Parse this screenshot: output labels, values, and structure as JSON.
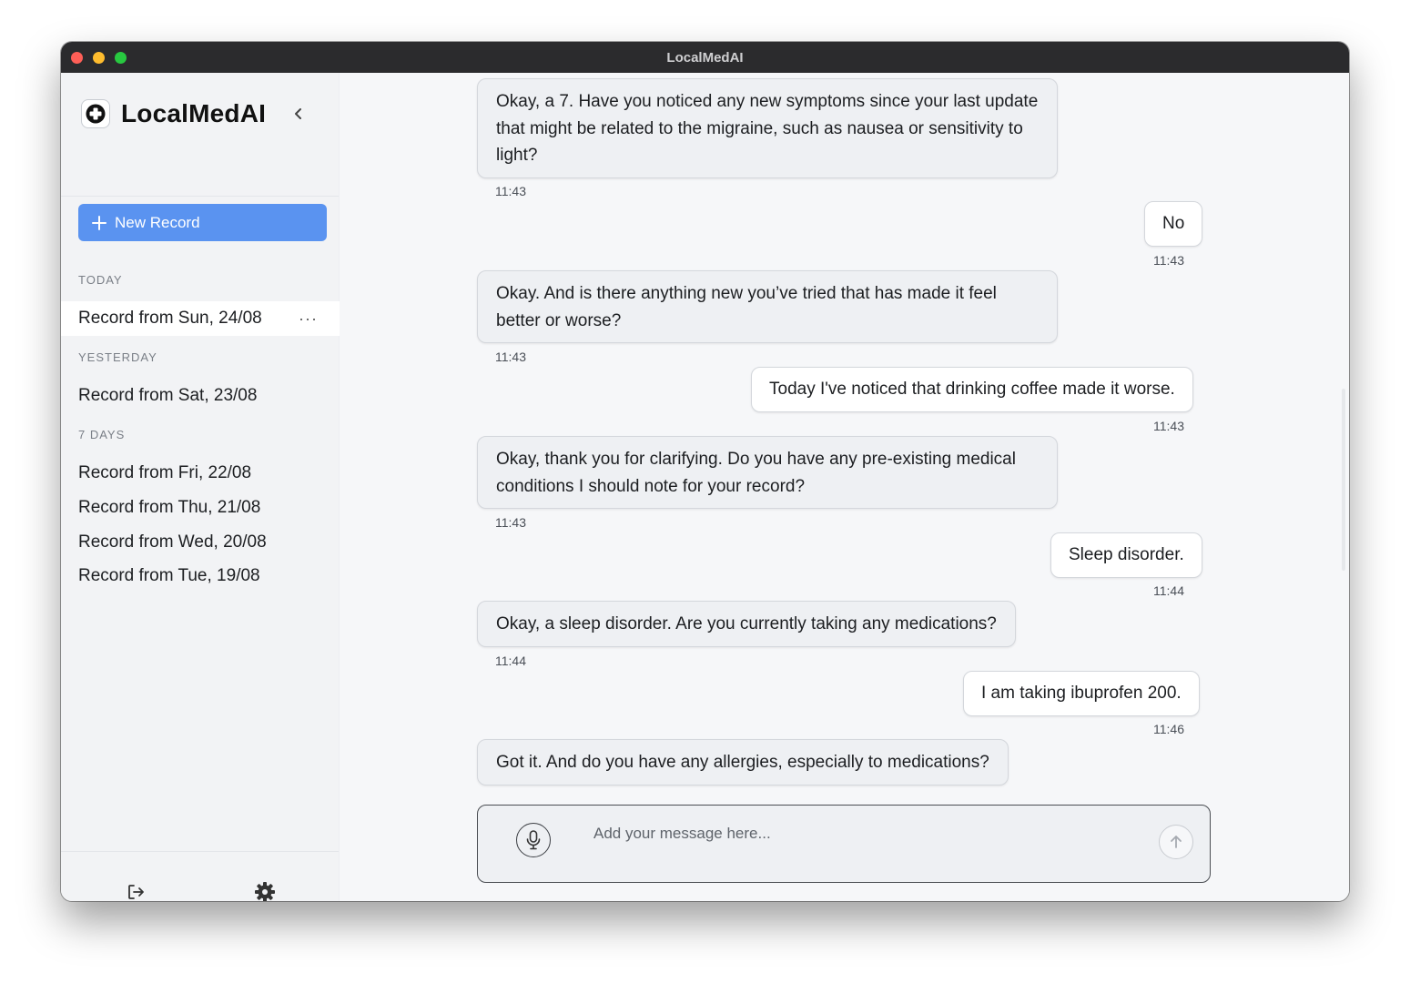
{
  "window": {
    "title": "LocalMedAI"
  },
  "sidebar": {
    "brand": "LocalMedAI",
    "new_record_label": "New Record",
    "sections": {
      "today": "TODAY",
      "yesterday": "YESTERDAY",
      "seven_days": "7 DAYS"
    },
    "today_items": [
      "Record from Sun, 24/08"
    ],
    "yesterday_items": [
      "Record from Sat, 23/08"
    ],
    "seven_day_items": [
      "Record from Fri, 22/08",
      "Record from Thu, 21/08",
      "Record from Wed, 20/08",
      "Record from Tue, 19/08"
    ],
    "active_item_menu": "···",
    "footer_icons": [
      "logout-icon",
      "gear-icon"
    ]
  },
  "chat": {
    "messages": [
      {
        "role": "assistant",
        "text": "Okay, a 7. Have you noticed any new symptoms since your last update that might be related to the migraine, such as nausea or sensitivity to light?",
        "time": "11:43"
      },
      {
        "role": "user",
        "text": "No",
        "time": "11:43"
      },
      {
        "role": "assistant",
        "text": "Okay. And is there anything new you’ve tried that has made it feel better or worse?",
        "time": "11:43"
      },
      {
        "role": "user",
        "text": "Today I've noticed that drinking coffee made it worse.",
        "time": "11:43"
      },
      {
        "role": "assistant",
        "text": "Okay, thank you for clarifying. Do you have any pre-existing medical conditions I should note for your record?",
        "time": "11:43"
      },
      {
        "role": "user",
        "text": "Sleep disorder.",
        "time": "11:44"
      },
      {
        "role": "assistant",
        "text": "Okay, a sleep disorder. Are you currently taking any medications?",
        "time": "11:44"
      },
      {
        "role": "user",
        "text": "I am taking ibuprofen 200.",
        "time": "11:46"
      },
      {
        "role": "assistant",
        "text": "Got it. And do you have any allergies, especially to medications?",
        "time": ""
      }
    ]
  },
  "composer": {
    "placeholder": "Add your message here...",
    "value": "",
    "icons": [
      "microphone-icon",
      "arrow-up-icon"
    ]
  },
  "colors": {
    "accent": "#5a93f0",
    "titlebar": "#2b2b2d",
    "sidebar_bg": "#f2f3f5",
    "main_bg": "#f6f7f9",
    "bot_bubble": "#eef0f3",
    "user_bubble": "#ffffff"
  }
}
